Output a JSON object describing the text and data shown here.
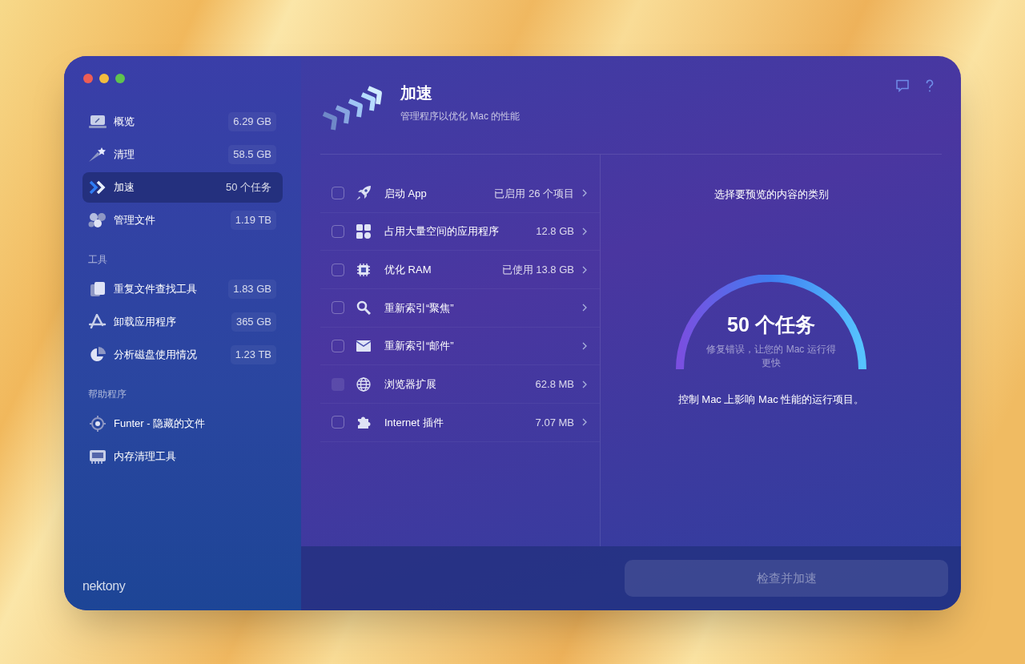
{
  "sidebar": {
    "groups": [
      {
        "items": [
          {
            "label": "概览",
            "badge": "6.29 GB",
            "selected": false
          },
          {
            "label": "清理",
            "badge": "58.5 GB",
            "selected": false
          },
          {
            "label": "加速",
            "badge": "50 个任务",
            "selected": true
          },
          {
            "label": "管理文件",
            "badge": "1.19 TB",
            "selected": false
          }
        ]
      },
      {
        "heading": "工具",
        "items": [
          {
            "label": "重复文件查找工具",
            "badge": "1.83 GB",
            "selected": false
          },
          {
            "label": "卸载应用程序",
            "badge": "365 GB",
            "selected": false
          },
          {
            "label": "分析磁盘使用情况",
            "badge": "1.23 TB",
            "selected": false
          }
        ]
      },
      {
        "heading": "帮助程序",
        "items": [
          {
            "label": "Funter - 隐藏的文件",
            "selected": false
          },
          {
            "label": "内存清理工具",
            "selected": false
          }
        ]
      }
    ],
    "brand": "nektony"
  },
  "header": {
    "title": "加速",
    "subtitle": "管理程序以优化 Mac 的性能"
  },
  "tasks": [
    {
      "label": "启动 App",
      "value": "已启用 26 个项目",
      "checked": false,
      "disabled": false
    },
    {
      "label": "占用大量空间的应用程序",
      "value": "12.8 GB",
      "checked": false,
      "disabled": false
    },
    {
      "label": "优化 RAM",
      "value": "已使用 13.8 GB",
      "checked": false,
      "disabled": false
    },
    {
      "label": "重新索引“聚焦”",
      "checked": false,
      "disabled": false
    },
    {
      "label": "重新索引“邮件”",
      "checked": false,
      "disabled": false
    },
    {
      "label": "浏览器扩展",
      "value": "62.8 MB",
      "checked": false,
      "disabled": true
    },
    {
      "label": "Internet 插件",
      "value": "7.07 MB",
      "checked": false,
      "disabled": false
    }
  ],
  "preview": {
    "prompt": "选择要预览的内容的类别",
    "gauge_title": "50 个任务",
    "gauge_subtitle": "修复错误，让您的 Mac 运行得更快",
    "description": "控制 Mac 上影响 Mac 性能的运行项目。"
  },
  "footer": {
    "button": "检查并加速",
    "button_disabled": true
  }
}
